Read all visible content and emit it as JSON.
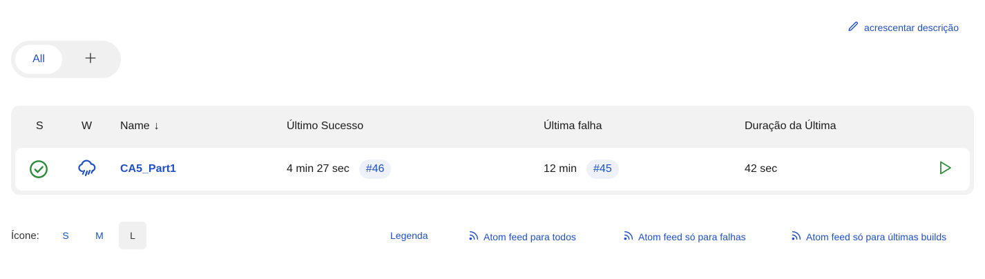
{
  "header": {
    "add_description": "acrescentar descrição",
    "add_description_icon": "pencil-icon"
  },
  "tabs": {
    "all_label": "All",
    "add_icon": "plus-icon"
  },
  "table": {
    "columns": {
      "status": "S",
      "weather": "W",
      "name": "Name",
      "name_sort": "↓",
      "last_success": "Último Sucesso",
      "last_failure": "Última falha",
      "last_duration": "Duração da Última"
    },
    "rows": [
      {
        "status_icon": "success-check-icon",
        "weather_icon": "rain-cloud-icon",
        "name": "CA5_Part1",
        "last_success_time": "4 min 27 sec",
        "last_success_build": "#46",
        "last_failure_time": "12 min",
        "last_failure_build": "#45",
        "last_duration": "42 sec",
        "action_icon": "play-icon"
      }
    ]
  },
  "footer": {
    "icon_label": "Ícone:",
    "sizes": [
      "S",
      "M",
      "L"
    ],
    "selected_size": "L",
    "legend": "Legenda",
    "feed_all": "Atom feed para todos",
    "feed_failures": "Atom feed só para falhas",
    "feed_latest": "Atom feed só para últimas builds"
  },
  "colors": {
    "link": "#1f4fc2",
    "success": "#2e8b3a",
    "panel": "#f2f2f2"
  }
}
